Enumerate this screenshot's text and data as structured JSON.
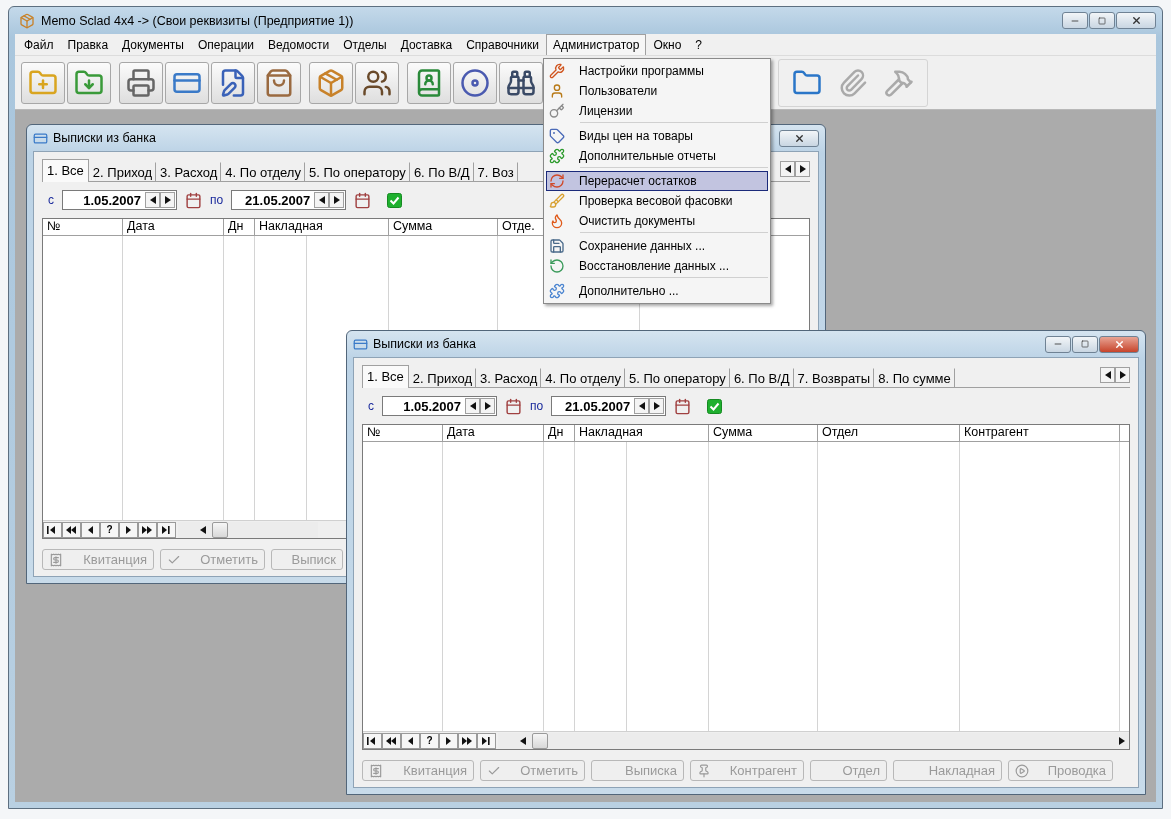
{
  "window": {
    "title": "Memo Sclad 4x4 -> (Свои реквизиты (Предприятие 1))"
  },
  "menu_bar": [
    {
      "label": "Файл",
      "selected": false
    },
    {
      "label": "Правка",
      "selected": false
    },
    {
      "label": "Документы",
      "selected": false
    },
    {
      "label": "Операции",
      "selected": false
    },
    {
      "label": "Ведомости",
      "selected": false
    },
    {
      "label": "Отделы",
      "selected": false
    },
    {
      "label": "Доставка",
      "selected": false
    },
    {
      "label": "Справочники",
      "selected": false
    },
    {
      "label": "Администратор",
      "selected": true
    },
    {
      "label": "Окно",
      "selected": false
    },
    {
      "label": "?",
      "selected": false
    }
  ],
  "toolbar": {
    "left": [
      {
        "disabled": false
      },
      {
        "disabled": false
      },
      {
        "disabled": false
      },
      {
        "disabled": false
      },
      {
        "disabled": false
      },
      {
        "disabled": false
      },
      {
        "disabled": false
      },
      {
        "disabled": false
      },
      {
        "disabled": false
      },
      {
        "disabled": false
      },
      {
        "disabled": false
      }
    ],
    "right": [
      {
        "disabled": false
      },
      {
        "disabled": true
      },
      {
        "disabled": true
      }
    ]
  },
  "dropdown": {
    "items": [
      {
        "label": "Настройки программы",
        "selected": false,
        "separator_before": false
      },
      {
        "label": "Пользователи",
        "selected": false,
        "separator_before": false
      },
      {
        "label": "Лицензии",
        "selected": false,
        "separator_before": false
      },
      {
        "label": "Виды цен на товары",
        "selected": false,
        "separator_before": true
      },
      {
        "label": "Дополнительные отчеты",
        "selected": false,
        "separator_before": false
      },
      {
        "label": "Перерасчет остатков",
        "selected": true,
        "separator_before": true
      },
      {
        "label": "Проверка весовой фасовки",
        "selected": false,
        "separator_before": false
      },
      {
        "label": "Очистить документы",
        "selected": false,
        "separator_before": false
      },
      {
        "label": "Сохранение данных ...",
        "selected": false,
        "separator_before": true
      },
      {
        "label": "Восстановление данных ...",
        "selected": false,
        "separator_before": false
      },
      {
        "label": "Дополнительно ...",
        "selected": false,
        "separator_before": true
      }
    ]
  },
  "child_windows": [
    {
      "title": "Выписки из банка",
      "active": false,
      "tabs": [
        {
          "label": "1. Все",
          "selected": true
        },
        {
          "label": "2. Приход",
          "selected": false
        },
        {
          "label": "3. Расход",
          "selected": false
        },
        {
          "label": "4. По отделу",
          "selected": false
        },
        {
          "label": "5. По оператору",
          "selected": false
        },
        {
          "label": "6. По В/Д",
          "selected": false
        },
        {
          "label": "7. Воз",
          "selected": false
        }
      ],
      "date_from_label": "с",
      "date_from": "1.05.2007",
      "date_to_label": "по",
      "date_to": "21.05.2007",
      "filter_checked": true,
      "columns": [
        "№",
        "Дата",
        "Дн",
        "Накладная",
        "Сумма",
        "Отде."
      ],
      "query_button": "?",
      "buttons": [
        {
          "label": "Квитанция",
          "disabled": true
        },
        {
          "label": "Отметить",
          "disabled": true
        },
        {
          "label": "Выписк",
          "disabled": true
        }
      ]
    },
    {
      "title": "Выписки из банка",
      "active": true,
      "tabs": [
        {
          "label": "1. Все",
          "selected": true
        },
        {
          "label": "2. Приход",
          "selected": false
        },
        {
          "label": "3. Расход",
          "selected": false
        },
        {
          "label": "4. По отделу",
          "selected": false
        },
        {
          "label": "5. По оператору",
          "selected": false
        },
        {
          "label": "6. По В/Д",
          "selected": false
        },
        {
          "label": "7. Возвраты",
          "selected": false
        },
        {
          "label": "8. По сумме",
          "selected": false
        }
      ],
      "date_from_label": "с",
      "date_from": "1.05.2007",
      "date_to_label": "по",
      "date_to": "21.05.2007",
      "filter_checked": true,
      "columns": [
        "№",
        "Дата",
        "Дн",
        "Накладная",
        "Сумма",
        "Отдел",
        "Контрагент"
      ],
      "query_button": "?",
      "buttons": [
        {
          "label": "Квитанция",
          "disabled": true
        },
        {
          "label": "Отметить",
          "disabled": true
        },
        {
          "label": "Выписка",
          "disabled": true
        },
        {
          "label": "Контрагент",
          "disabled": true
        },
        {
          "label": "Отдел",
          "disabled": true
        },
        {
          "label": "Накладная",
          "disabled": true
        },
        {
          "label": "Проводка",
          "disabled": true
        }
      ]
    }
  ]
}
